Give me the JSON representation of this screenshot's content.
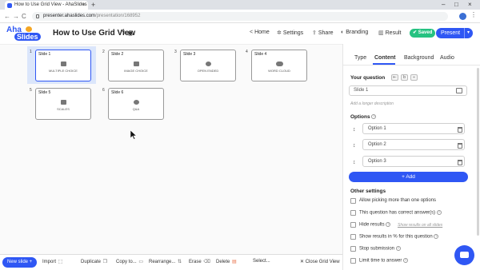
{
  "browser": {
    "tab_title": "How to Use Grid View - AhaSlides",
    "tab_close": "×",
    "new_tab": "+",
    "url_host": "presenter.ahaslides.com",
    "url_path": "/presentation/168952",
    "back": "←",
    "forward": "→",
    "reload": "C",
    "menu": "⋮",
    "minimize": "–",
    "maximize": "□",
    "close": "×"
  },
  "header": {
    "logo_top": "Aha",
    "logo_bottom": "Slides",
    "title": "How to Use Grid View",
    "home": "Home",
    "settings": "Settings",
    "share": "Share",
    "branding": "Branding",
    "result": "Result",
    "saved": "✔ Saved",
    "present": "Present",
    "present_dd": "▾"
  },
  "slides": [
    {
      "num": "1",
      "title": "Slide 1",
      "type": "Multiple Choice",
      "icon": "bar-chart-icon"
    },
    {
      "num": "2",
      "title": "Slide 2",
      "type": "Image Choice",
      "icon": "image-icon"
    },
    {
      "num": "3",
      "title": "Slide 3",
      "type": "Open Ended",
      "icon": "speech-bubble-icon"
    },
    {
      "num": "4",
      "title": "Slide 4",
      "type": "Word Cloud",
      "icon": "cloud-icon"
    },
    {
      "num": "5",
      "title": "Slide 5",
      "type": "Scales",
      "icon": "scales-icon"
    },
    {
      "num": "6",
      "title": "Slide 6",
      "type": "Q&A",
      "icon": "qa-icon"
    }
  ],
  "bottom": {
    "new_slide": "New slide +",
    "import": "Import",
    "duplicate": "Duplicate",
    "copy_to": "Copy to...",
    "rearrange": "Rearrange...",
    "erase": "Erase",
    "delete": "Delete",
    "select": "Select...",
    "close_grid": "✕ Close Grid View"
  },
  "panel": {
    "tabs": [
      "Type",
      "Content",
      "Background",
      "Audio"
    ],
    "your_question": "Your question",
    "question_value": "Slide 1",
    "add_desc": "Add a longer description",
    "options_label": "Options",
    "options": [
      "Option 1",
      "Option 2",
      "Option 3"
    ],
    "add": "+ Add",
    "other_settings": "Other settings",
    "checks": [
      "Allow picking more than one options",
      "This question has correct answer(s)",
      "Hide results",
      "Show results in % for this question",
      "Stop submission",
      "Limit time to answer"
    ],
    "show_results_link": "Show results on all slides",
    "help": "?"
  },
  "colors": {
    "brand": "#2f57f4",
    "saved": "#26c281"
  }
}
